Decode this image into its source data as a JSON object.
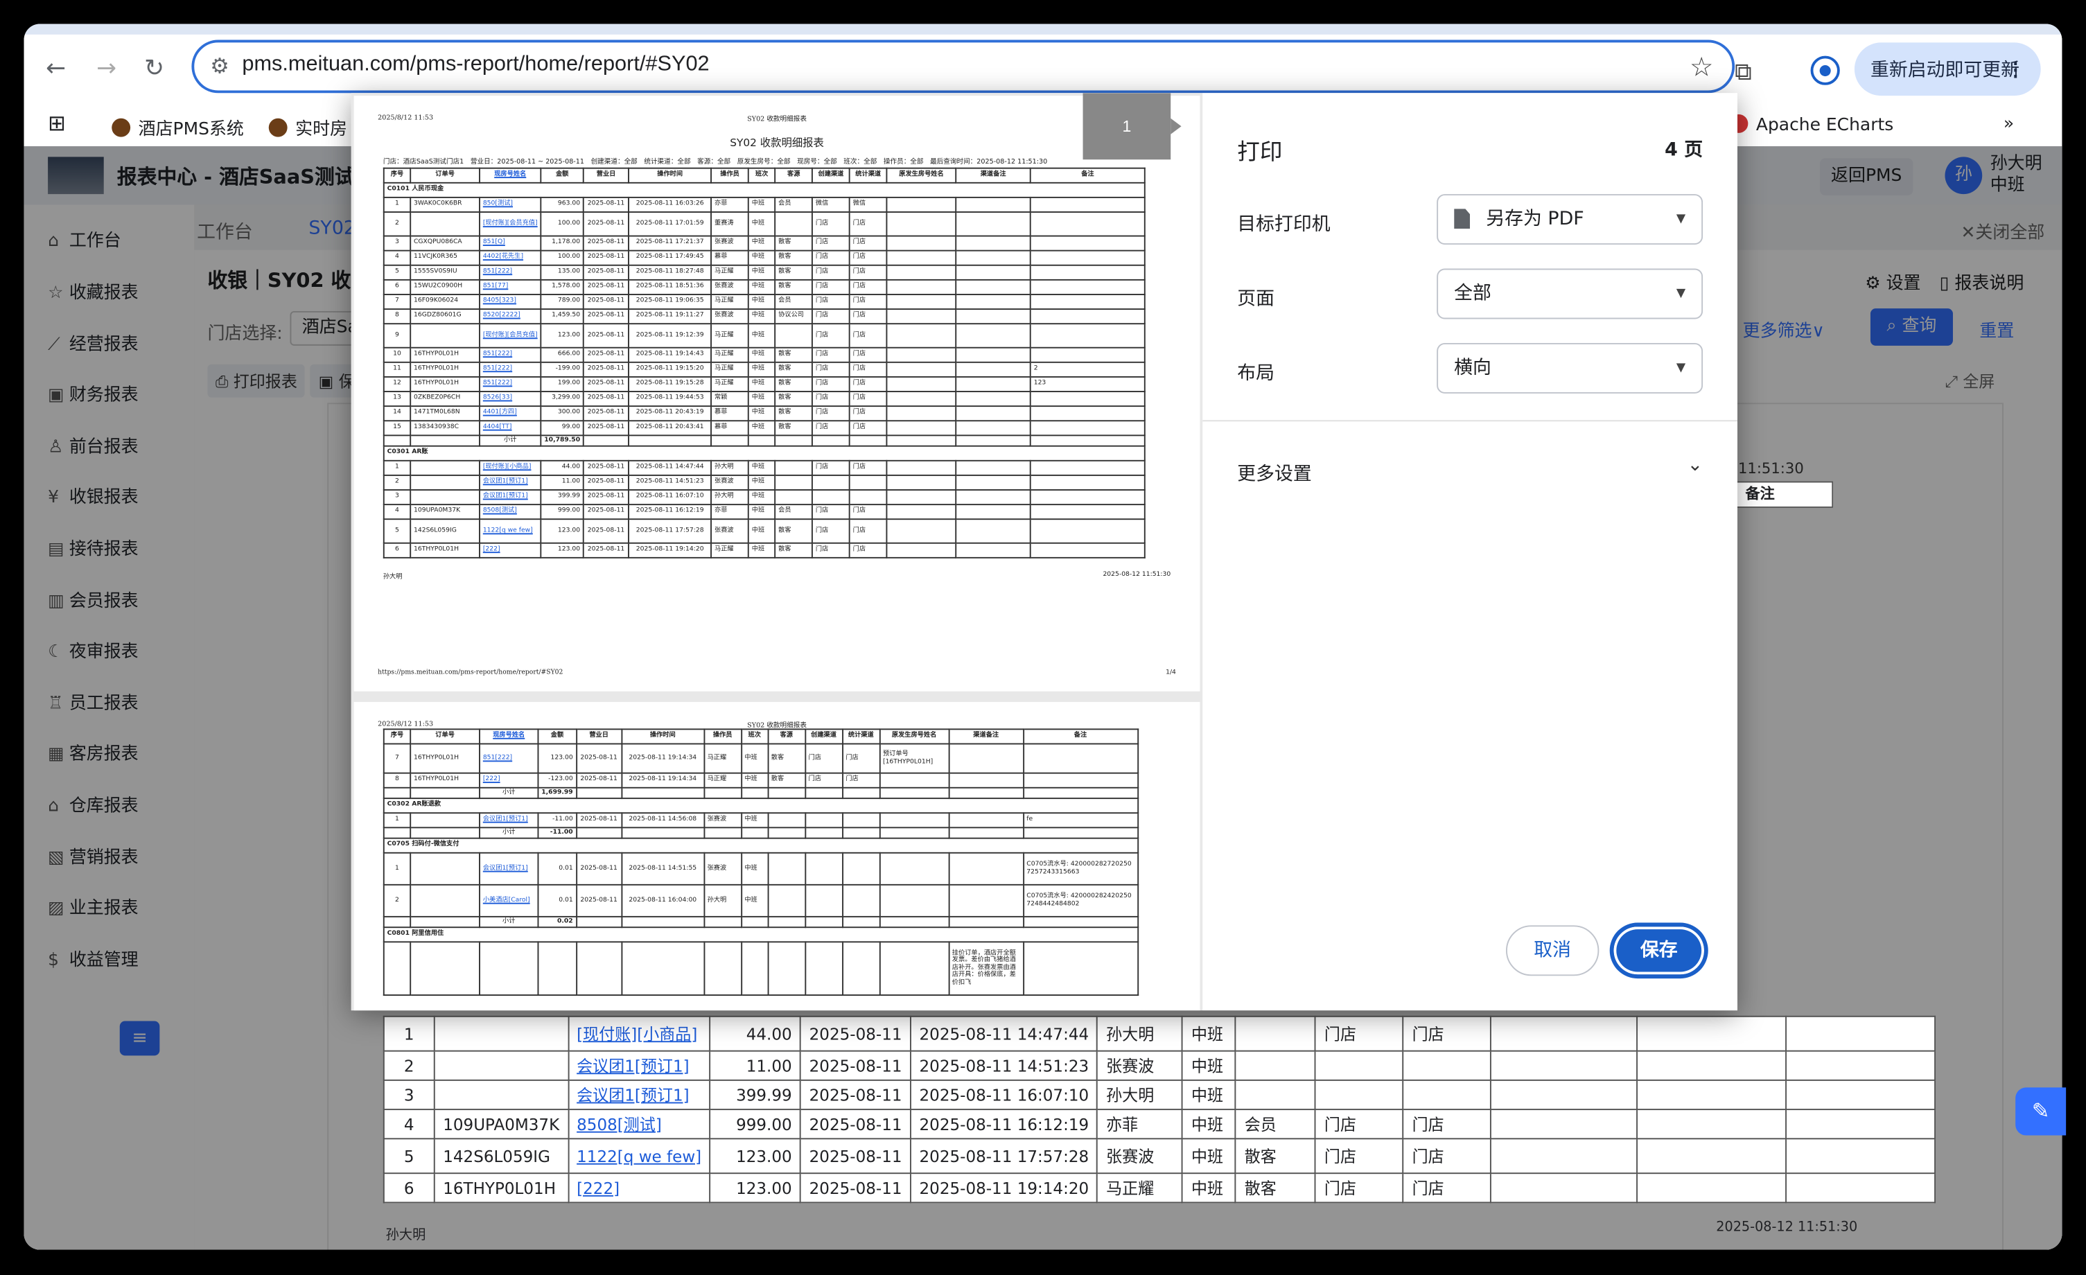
{
  "browser": {
    "url": "pms.meituan.com/pms-report/home/report/#SY02",
    "update_label": "重新启动即可更新"
  },
  "bookmarks": [
    "酒店PMS系统",
    "实时房",
    "Apache ECharts"
  ],
  "app": {
    "title": "报表中心 - 酒店SaaS测试门",
    "back_label": "返回PMS",
    "avatar": "孙",
    "user_name": "孙大明",
    "user_shift": "中班"
  },
  "sidebar": [
    "工作台",
    "收藏报表",
    "经营报表",
    "财务报表",
    "前台报表",
    "收银报表",
    "接待报表",
    "会员报表",
    "夜审报表",
    "员工报表",
    "客房报表",
    "仓库报表",
    "营销报表",
    "业主报表",
    "收益管理"
  ],
  "tabs": {
    "home": "工作台",
    "current": "SY02",
    "close_all": "关闭全部"
  },
  "page": {
    "title": "收银｜SY02 收款",
    "store_label": "门店选择:",
    "store_value": "酒店Sa",
    "settings": "设置",
    "report_desc": "报表说明",
    "more_filter": "更多筛选",
    "query": "查询",
    "reset": "重置",
    "print": "打印报表",
    "save": "保存",
    "fullscreen": "全屏"
  },
  "background_report": {
    "time": "2 11:51:30",
    "col_note": "备注",
    "footer_user": "孙大明",
    "footer_time": "2025-08-12 11:51:30",
    "rows": [
      [
        "1",
        "",
        "[现付账][小商品]",
        "44.00",
        "2025-08-11",
        "2025-08-11 14:47:44",
        "孙大明",
        "中班",
        "",
        "门店",
        "门店"
      ],
      [
        "2",
        "",
        "会议团1[预订1]",
        "11.00",
        "2025-08-11",
        "2025-08-11 14:51:23",
        "张赛波",
        "中班",
        "",
        "",
        ""
      ],
      [
        "3",
        "",
        "会议团1[预订1]",
        "399.99",
        "2025-08-11",
        "2025-08-11 16:07:10",
        "孙大明",
        "中班",
        "",
        "",
        ""
      ],
      [
        "4",
        "109UPA0M37K",
        "8508[测试]",
        "999.00",
        "2025-08-11",
        "2025-08-11 16:12:19",
        "亦菲",
        "中班",
        "会员",
        "门店",
        "门店"
      ],
      [
        "5",
        "142S6L059IG",
        "1122[q we few]",
        "123.00",
        "2025-08-11",
        "2025-08-11 17:57:28",
        "张赛波",
        "中班",
        "散客",
        "门店",
        "门店"
      ],
      [
        "6",
        "16THYP0L01H",
        "[222]",
        "123.00",
        "2025-08-11",
        "2025-08-11 19:14:20",
        "马正耀",
        "中班",
        "散客",
        "门店",
        "门店"
      ]
    ]
  },
  "print_dialog": {
    "title": "打印",
    "page_count": "4 页",
    "printer_label": "目标打印机",
    "printer_value": "另存为 PDF",
    "pages_label": "页面",
    "pages_value": "全部",
    "layout_label": "布局",
    "layout_value": "横向",
    "more_settings": "更多设置",
    "cancel": "取消",
    "save": "保存",
    "page_tip": "1"
  },
  "preview": {
    "timestamp": "2025/8/12 11:53",
    "header_title": "SY02 收款明细报表",
    "report_title": "SY02 收款明细报表",
    "meta": "门店：酒店SaaS测试门店1　营业日：2025-08-11 ~ 2025-08-11　创建渠道：全部　统计渠道：全部　客源：全部　原发生房号：全部　现房号：全部　班次：全部　操作员：全部　最后查询时间：2025-08-12 11:51:30",
    "columns": [
      "序号",
      "订单号",
      "现房号姓名",
      "金额",
      "营业日",
      "操作时间",
      "操作员",
      "班次",
      "客源",
      "创建渠道",
      "统计渠道",
      "原发生房号姓名",
      "渠道备注",
      "备注"
    ],
    "page1_sections": [
      {
        "name": "C0101 人民币现金",
        "rows": [
          [
            "1",
            "3WAK0C0K6BR",
            "850[测试]",
            "963.00",
            "2025-08-11",
            "2025-08-11 16:03:26",
            "亦菲",
            "中班",
            "会员",
            "微信",
            "微信",
            "",
            "",
            ""
          ],
          [
            "2",
            "",
            "[现付账][会员充值]",
            "100.00",
            "2025-08-11",
            "2025-08-11 17:01:59",
            "董赛涛",
            "中班",
            "",
            "门店",
            "门店",
            "",
            "",
            ""
          ],
          [
            "3",
            "CGXQPU086CA",
            "851[Q]",
            "1,178.00",
            "2025-08-11",
            "2025-08-11 17:21:37",
            "张赛波",
            "中班",
            "散客",
            "门店",
            "门店",
            "",
            "",
            ""
          ],
          [
            "4",
            "11VCJK0R365",
            "4402[花先生]",
            "100.00",
            "2025-08-11",
            "2025-08-11 17:49:45",
            "慕菲",
            "中班",
            "散客",
            "门店",
            "门店",
            "",
            "",
            ""
          ],
          [
            "5",
            "1555SV0S9IU",
            "851[222]",
            "135.00",
            "2025-08-11",
            "2025-08-11 18:27:48",
            "马正耀",
            "中班",
            "散客",
            "门店",
            "门店",
            "",
            "",
            ""
          ],
          [
            "6",
            "15WU2C0900H",
            "851[77]",
            "1,578.00",
            "2025-08-11",
            "2025-08-11 18:51:36",
            "张赛波",
            "中班",
            "散客",
            "门店",
            "门店",
            "",
            "",
            ""
          ],
          [
            "7",
            "16F09K06024",
            "8405[323]",
            "789.00",
            "2025-08-11",
            "2025-08-11 19:06:35",
            "马正耀",
            "中班",
            "会员",
            "门店",
            "门店",
            "",
            "",
            ""
          ],
          [
            "8",
            "16GDZ80601G",
            "8520[2222]",
            "1,459.50",
            "2025-08-11",
            "2025-08-11 19:11:27",
            "张赛波",
            "中班",
            "协议公司",
            "门店",
            "门店",
            "",
            "",
            ""
          ],
          [
            "9",
            "",
            "[现付账][会员充值]",
            "123.00",
            "2025-08-11",
            "2025-08-11 19:12:39",
            "马正耀",
            "中班",
            "",
            "门店",
            "门店",
            "",
            "",
            ""
          ],
          [
            "10",
            "16THYP0L01H",
            "851[222]",
            "666.00",
            "2025-08-11",
            "2025-08-11 19:14:43",
            "马正耀",
            "中班",
            "散客",
            "门店",
            "门店",
            "",
            "",
            ""
          ],
          [
            "11",
            "16THYP0L01H",
            "851[222]",
            "-199.00",
            "2025-08-11",
            "2025-08-11 19:15:20",
            "马正耀",
            "中班",
            "散客",
            "门店",
            "门店",
            "",
            "",
            "2"
          ],
          [
            "12",
            "16THYP0L01H",
            "851[222]",
            "199.00",
            "2025-08-11",
            "2025-08-11 19:15:28",
            "马正耀",
            "中班",
            "散客",
            "门店",
            "门店",
            "",
            "",
            "123"
          ],
          [
            "13",
            "0ZKBEZ0P6CH",
            "8526[33]",
            "3,299.00",
            "2025-08-11",
            "2025-08-11 19:44:53",
            "常颖",
            "中班",
            "散客",
            "门店",
            "门店",
            "",
            "",
            ""
          ],
          [
            "14",
            "1471TM0L68N",
            "4401[方四]",
            "300.00",
            "2025-08-11",
            "2025-08-11 20:43:19",
            "慕菲",
            "中班",
            "散客",
            "门店",
            "门店",
            "",
            "",
            ""
          ],
          [
            "15",
            "1383430938C",
            "4404[TT]",
            "99.00",
            "2025-08-11",
            "2025-08-11 20:43:41",
            "慕菲",
            "中班",
            "散客",
            "门店",
            "门店",
            "",
            "",
            ""
          ]
        ],
        "subtotal": "10,789.50"
      },
      {
        "name": "C0301 AR账",
        "rows": [
          [
            "1",
            "",
            "[现付账][小商品]",
            "44.00",
            "2025-08-11",
            "2025-08-11 14:47:44",
            "孙大明",
            "中班",
            "",
            "门店",
            "门店",
            "",
            "",
            ""
          ],
          [
            "2",
            "",
            "会议团1[预订1]",
            "11.00",
            "2025-08-11",
            "2025-08-11 14:51:23",
            "张赛波",
            "中班",
            "",
            "",
            "",
            "",
            "",
            ""
          ],
          [
            "3",
            "",
            "会议团1[预订1]",
            "399.99",
            "2025-08-11",
            "2025-08-11 16:07:10",
            "孙大明",
            "中班",
            "",
            "",
            "",
            "",
            "",
            ""
          ],
          [
            "4",
            "109UPA0M37K",
            "8508[测试]",
            "999.00",
            "2025-08-11",
            "2025-08-11 16:12:19",
            "亦菲",
            "中班",
            "会员",
            "门店",
            "门店",
            "",
            "",
            ""
          ],
          [
            "5",
            "142S6L059IG",
            "1122[q we few]",
            "123.00",
            "2025-08-11",
            "2025-08-11 17:57:28",
            "张赛波",
            "中班",
            "散客",
            "门店",
            "门店",
            "",
            "",
            ""
          ],
          [
            "6",
            "16THYP0L01H",
            "[222]",
            "123.00",
            "2025-08-11",
            "2025-08-11 19:14:20",
            "马正耀",
            "中班",
            "散客",
            "门店",
            "门店",
            "",
            "",
            ""
          ]
        ]
      }
    ],
    "page1_footer_user": "孙大明",
    "page1_footer_time": "2025-08-12 11:51:30",
    "page1_url": "https://pms.meituan.com/pms-report/home/report/#SY02",
    "page1_num": "1/4",
    "page2_rows": [
      [
        "7",
        "16THYP0L01H",
        "851[222]",
        "123.00",
        "2025-08-11",
        "2025-08-11 19:14:34",
        "马正耀",
        "中班",
        "散客",
        "门店",
        "门店",
        "预订单号[16THYP0L01H]",
        "",
        ""
      ],
      [
        "8",
        "16THYP0L01H",
        "[222]",
        "-123.00",
        "2025-08-11",
        "2025-08-11 19:14:34",
        "马正耀",
        "中班",
        "散客",
        "门店",
        "门店",
        "",
        "",
        ""
      ]
    ],
    "page2_subtotal1": "1,699.99",
    "page2_sec2": "C0302 AR账退款",
    "page2_sec2_row": [
      "1",
      "",
      "会议团1[预订1]",
      "-11.00",
      "2025-08-11",
      "2025-08-11 14:56:08",
      "张赛波",
      "中班",
      "",
      "",
      "",
      "",
      "",
      "fe"
    ],
    "page2_subtotal2": "-11.00",
    "page2_sec3": "C0705 扫码付-微信支付",
    "page2_sec3_rows": [
      [
        "1",
        "",
        "会议团1[预订1]",
        "0.01",
        "2025-08-11",
        "2025-08-11 14:51:55",
        "张赛波",
        "中班",
        "",
        "",
        "",
        "",
        "",
        "C0705流水号: 420000282720250 7257243315663"
      ],
      [
        "2",
        "",
        "小美酒店[Carol]",
        "0.01",
        "2025-08-11",
        "2025-08-11 16:04:00",
        "孙大明",
        "中班",
        "",
        "",
        "",
        "",
        "",
        "C0705流水号: 420000282420250 7248442484802"
      ]
    ],
    "page2_subtotal3": "0.02",
    "page2_sec4": "C0801 阿里信用住",
    "page2_sec4_note": "挂价订单，酒店开全额发票。差价由飞猪给酒店补开。张赛发票由酒店开具：价格保底，差价扣飞",
    "subtotal_label": "小计"
  }
}
